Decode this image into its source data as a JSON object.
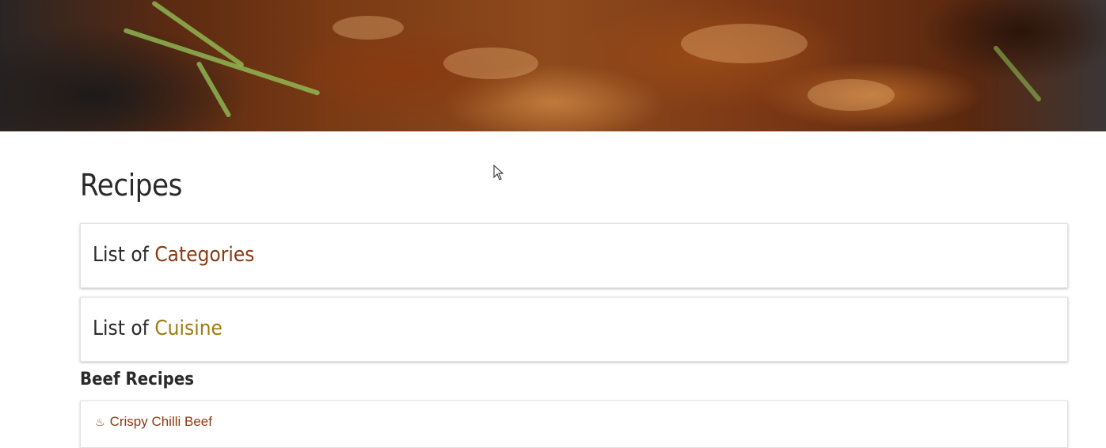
{
  "page": {
    "title": "Recipes"
  },
  "cards": [
    {
      "prefix": "List of ",
      "accent": "Categories",
      "accent_color": "#8b3a12"
    },
    {
      "prefix": "List of ",
      "accent": "Cuisine",
      "accent_color": "#a07c14"
    }
  ],
  "beef_section": {
    "heading": "Beef Recipes",
    "items": [
      {
        "icon": "steaming-dish-icon",
        "label": "Crispy Chilli Beef"
      }
    ]
  },
  "colors": {
    "text": "#2a2a2a",
    "link": "#8b3a12",
    "cuisine_accent": "#a07c14",
    "card_border": "#e2e2e2"
  }
}
